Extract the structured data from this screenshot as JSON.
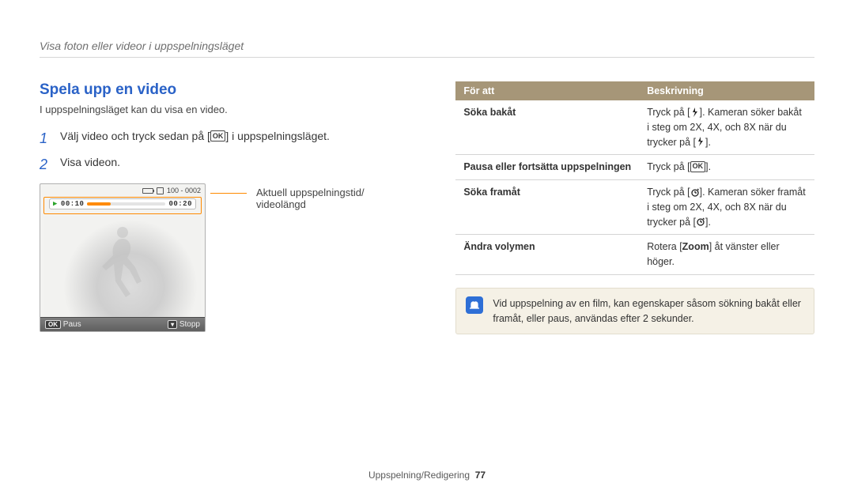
{
  "breadcrumb": "Visa foton eller videor i uppspelningsläget",
  "section": {
    "title": "Spela upp en video",
    "intro": "I uppspelningsläget kan du visa en video.",
    "steps": [
      {
        "num": "1",
        "before": "Välj video och tryck sedan på [",
        "ok": "OK",
        "after": "] i uppspelningsläget."
      },
      {
        "num": "2",
        "before": "Visa videon.",
        "ok": "",
        "after": ""
      }
    ]
  },
  "camera": {
    "counter": "100 - 0002",
    "time_current": "00:10",
    "time_total": "00:20",
    "pause_label": "Paus",
    "stop_label": "Stopp",
    "ok": "OK"
  },
  "callout": {
    "line1": "Aktuell uppspelningstid/",
    "line2": "videolängd"
  },
  "table": {
    "head_action": "För att",
    "head_desc": "Beskrivning",
    "rows": {
      "seek_back": {
        "label": "Söka bakåt",
        "d1": "Tryck på [",
        "d2": "]. Kameran söker bakåt i steg om 2X, 4X, och 8X när du trycker på [",
        "d3": "]."
      },
      "pause_resume": {
        "label": "Pausa eller fortsätta uppspelningen",
        "d1": "Tryck på [",
        "ok": "OK",
        "d2": "]."
      },
      "seek_fwd": {
        "label": "Söka framåt",
        "d1": "Tryck på [",
        "d2": "]. Kameran söker framåt i steg om 2X, 4X, och 8X när du trycker på [",
        "d3": "]."
      },
      "volume": {
        "label": "Ändra volymen",
        "d1": "Rotera [",
        "zoom": "Zoom",
        "d2": "] åt vänster eller höger."
      }
    }
  },
  "note": {
    "text": "Vid uppspelning av en film, kan egenskaper såsom sökning bakåt eller framåt, eller paus, användas efter 2 sekunder."
  },
  "footer": {
    "section": "Uppspelning/Redigering",
    "page": "77"
  }
}
